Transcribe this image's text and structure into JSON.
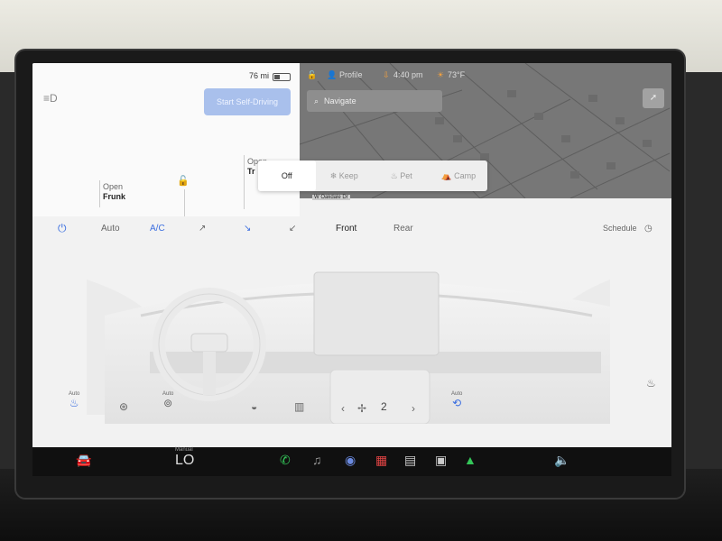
{
  "status_bar": {
    "range": "76 mi",
    "profile_label": "Profile",
    "time": "4:40 pm",
    "temperature": "73°F"
  },
  "car_panel": {
    "fsd_button": "Start Self-Driving",
    "frunk": {
      "label": "Open",
      "name": "Frunk"
    },
    "trunk": {
      "label": "Open",
      "name": "Tr"
    }
  },
  "map": {
    "navigate_placeholder": "Navigate",
    "street_label": "W Oakdale Dr"
  },
  "climate_mode": {
    "options": [
      "Off",
      "Keep",
      "Pet",
      "Camp"
    ],
    "selected": "Off"
  },
  "climate_controls": {
    "auto": "Auto",
    "ac": "A/C",
    "front": "Front",
    "rear": "Rear",
    "schedule": "Schedule"
  },
  "bottom_controls": {
    "seat_heat_left_label": "Auto",
    "steering_heat_label": "Auto",
    "recirc_label": "Auto",
    "fan_speed": "2"
  },
  "dock": {
    "manual_label": "Manual",
    "temp_setting": "LO"
  },
  "colors": {
    "accent_blue": "#3c6fe0",
    "fsd_button_bg": "#a9c0ec",
    "map_bg": "#7a7a7a",
    "dock_bg": "#101010",
    "phone_green": "#34c759"
  }
}
